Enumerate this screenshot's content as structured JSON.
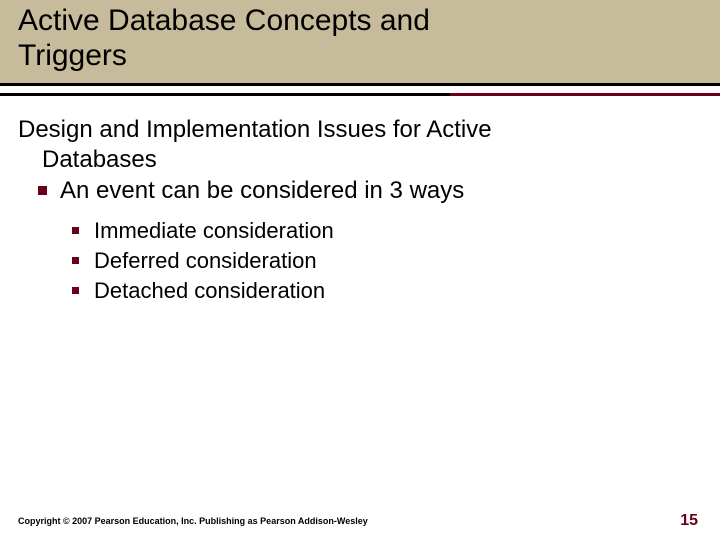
{
  "title": {
    "line1": "Active Database Concepts and",
    "line2": "Triggers"
  },
  "subtitle": {
    "line1": "Design and Implementation Issues for Active",
    "line2": "Databases"
  },
  "bullet_lvl1": "An event can be considered in 3 ways",
  "bullets_lvl2": {
    "0": "Immediate consideration",
    "1": "Deferred consideration",
    "2": "Detached consideration"
  },
  "footer": "Copyright © 2007 Pearson Education, Inc. Publishing as Pearson Addison-Wesley",
  "page_number": "15"
}
